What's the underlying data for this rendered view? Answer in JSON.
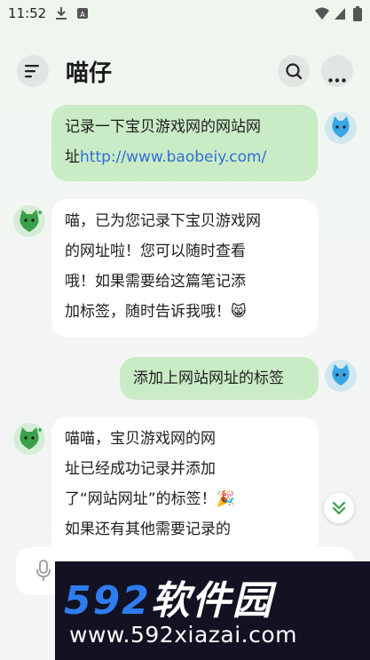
{
  "status_bar": {
    "time": "11:52"
  },
  "header": {
    "title": "喵仔"
  },
  "messages": [
    {
      "role": "user",
      "line1": "记录一下宝贝游戏网的网站网",
      "line2_prefix": "址",
      "link": "http://www.baobeiy.com/"
    },
    {
      "role": "bot",
      "lines": [
        "喵，已为您记录下宝贝游戏网",
        "的网址啦！您可以随时查看",
        "哦！如果需要给这篇笔记添",
        "加标签，随时告诉我哦！😸"
      ]
    },
    {
      "role": "user",
      "text": "添加上网站网址的标签"
    },
    {
      "role": "bot",
      "lines": [
        "喵喵，宝贝游戏网的网",
        "址已经成功记录并添加",
        "了“网站网址”的标签！🎉",
        "如果还有其他需要记录的"
      ]
    }
  ],
  "watermark": {
    "brand_num": "592",
    "brand_cn": "软件园",
    "url": "www.592xiazai.com"
  },
  "colors": {
    "user_bubble": "#c9ebc5",
    "bot_bubble": "#ffffff",
    "link": "#2f6fd6",
    "accent_green": "#3aa04a"
  },
  "icons": [
    "download-icon",
    "sim-icon",
    "wifi-icon",
    "signal-icon",
    "battery-icon",
    "menu-icon",
    "search-icon",
    "more-icon",
    "chevron-double-down-icon",
    "microphone-icon"
  ]
}
